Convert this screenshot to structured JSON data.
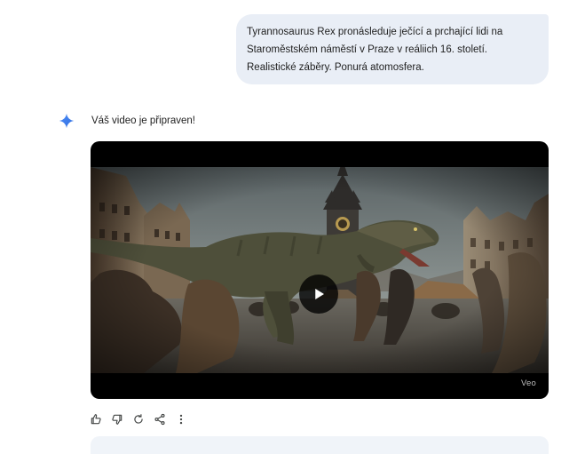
{
  "conversation": {
    "user_prompt": "Tyrannosaurus Rex pronásleduje ječící a prchající lidi na Staroměstském náměstí v Praze v reáliich 16. století. Realistické záběry. Ponurá atomosfera.",
    "response_text": "Váš video je připraven!",
    "video": {
      "watermark": "Veo",
      "play_icon": "play-icon"
    }
  },
  "actions": [
    {
      "name": "thumbs-up-icon"
    },
    {
      "name": "thumbs-down-icon"
    },
    {
      "name": "regenerate-icon"
    },
    {
      "name": "share-icon"
    },
    {
      "name": "more-vert-icon"
    }
  ],
  "colors": {
    "bubble_bg": "#e9eef6",
    "gemini_blue": "#4285f4",
    "video_bg": "#000000"
  }
}
